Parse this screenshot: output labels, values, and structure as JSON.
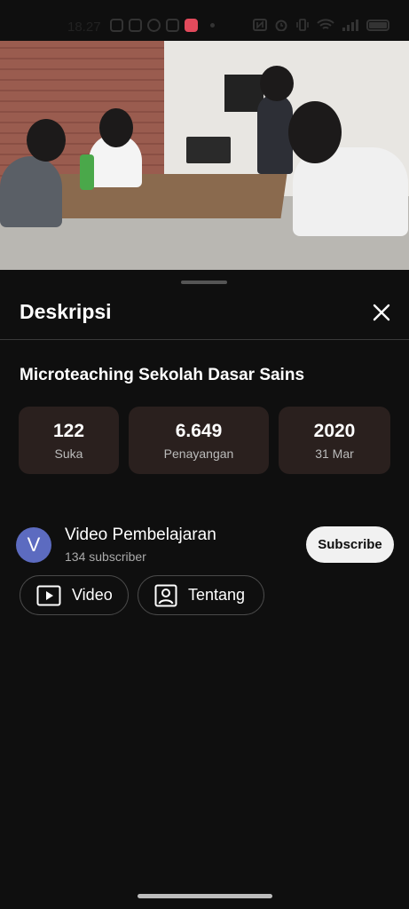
{
  "status_bar": {
    "time": "18.27"
  },
  "sheet": {
    "title": "Deskripsi",
    "video_title": "Microteaching Sekolah Dasar Sains",
    "stats": [
      {
        "value": "122",
        "label": "Suka"
      },
      {
        "value": "6.649",
        "label": "Penayangan"
      },
      {
        "value": "2020",
        "label": "31 Mar"
      }
    ],
    "channel": {
      "avatar_letter": "V",
      "name": "Video Pembelajaran",
      "subscribers": "134 subscriber",
      "subscribe_label": "Subscribe"
    },
    "buttons": {
      "video_label": "Video",
      "about_label": "Tentang"
    }
  },
  "colors": {
    "accent_avatar": "#5c6bc0",
    "stat_bg": "#2a201e",
    "sheet_bg": "#0f0f0f"
  },
  "icons": [
    "instagram-icon",
    "instagram-icon",
    "whatsapp-icon",
    "instagram-icon",
    "app-icon",
    "nfc-icon",
    "alarm-icon",
    "vibrate-icon",
    "wifi-icon",
    "signal-icon",
    "battery-icon",
    "close-icon",
    "video-icon",
    "profile-icon"
  ]
}
